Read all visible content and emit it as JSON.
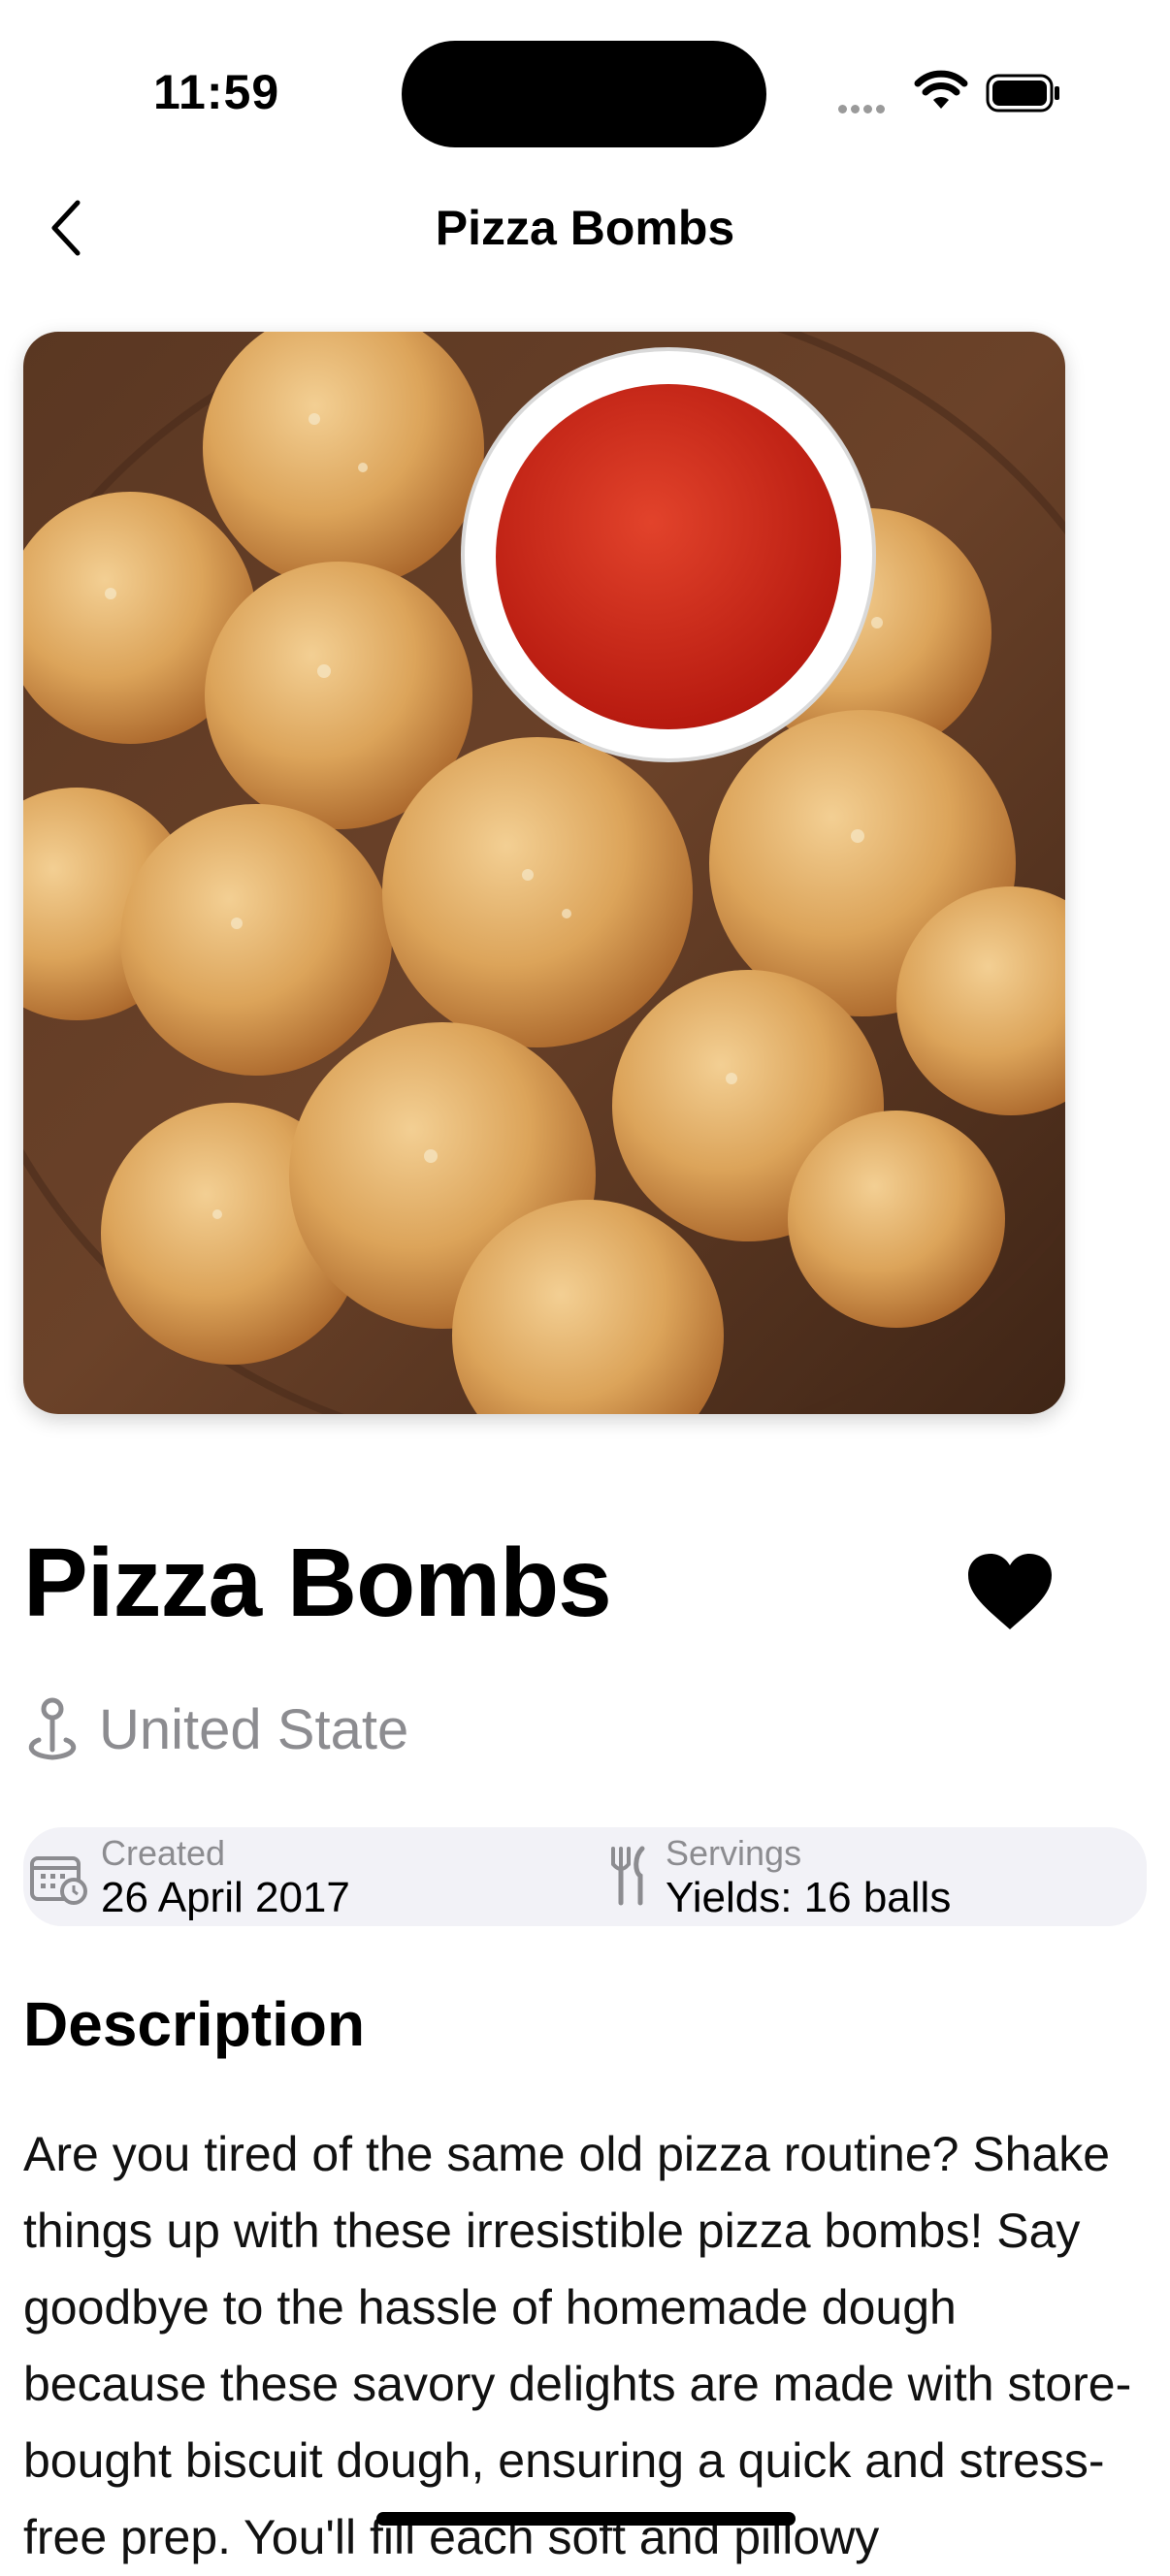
{
  "status_bar": {
    "time": "11:59"
  },
  "nav": {
    "title": "Pizza Bombs",
    "back_icon": "chevron-left-icon"
  },
  "recipe": {
    "image_alt": "Pizza bombs with marinara dipping sauce",
    "title": "Pizza Bombs",
    "favorite_icon": "heart-icon",
    "origin": "United State",
    "created_label": "Created",
    "created_value": "26 April 2017",
    "servings_label": "Servings",
    "servings_value": "Yields: 16 balls"
  },
  "description": {
    "heading": "Description",
    "text": "Are you tired of the same old pizza routine? Shake things up with these irresistible pizza bombs! Say goodbye to the hassle of homemade dough because these savory delights are made with store-bought biscuit dough, ensuring a quick and stress-free prep. You'll fill each soft and pillowy"
  }
}
